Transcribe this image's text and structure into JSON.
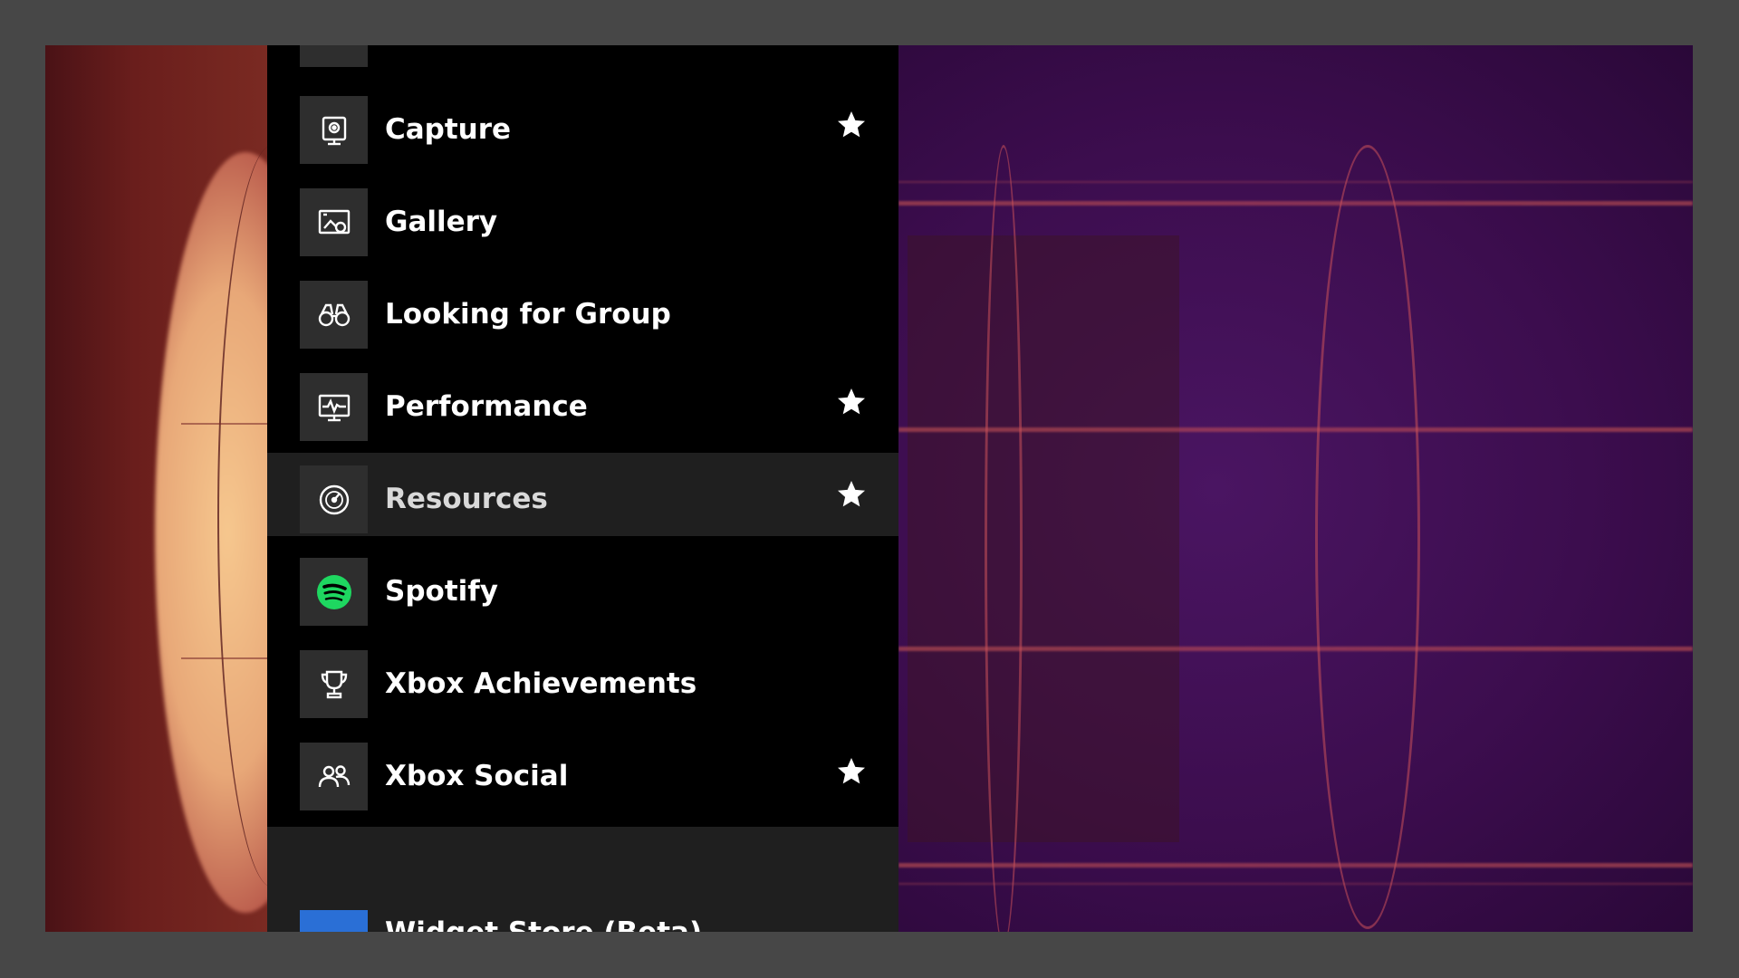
{
  "menu": {
    "items": [
      {
        "label": "Capture",
        "icon": "capture-icon",
        "favorite": true,
        "selected": false
      },
      {
        "label": "Gallery",
        "icon": "gallery-icon",
        "favorite": false,
        "selected": false
      },
      {
        "label": "Looking for Group",
        "icon": "binoculars-icon",
        "favorite": false,
        "selected": false
      },
      {
        "label": "Performance",
        "icon": "performance-monitor-icon",
        "favorite": true,
        "selected": false
      },
      {
        "label": "Resources",
        "icon": "gauge-icon",
        "favorite": true,
        "selected": true
      },
      {
        "label": "Spotify",
        "icon": "spotify-icon",
        "favorite": false,
        "selected": false
      },
      {
        "label": "Xbox Achievements",
        "icon": "trophy-icon",
        "favorite": false,
        "selected": false
      },
      {
        "label": "Xbox Social",
        "icon": "people-icon",
        "favorite": true,
        "selected": false
      }
    ],
    "store": {
      "label": "Widget Store (Beta)",
      "icon": "widget-store-icon"
    }
  },
  "colors": {
    "panel": "#000000",
    "selected_row": "#1f1f1f",
    "tile": "#2e2e2e",
    "spotify_green": "#1ed760",
    "store_blue": "#2a6fd6",
    "star": "#ffffff"
  }
}
